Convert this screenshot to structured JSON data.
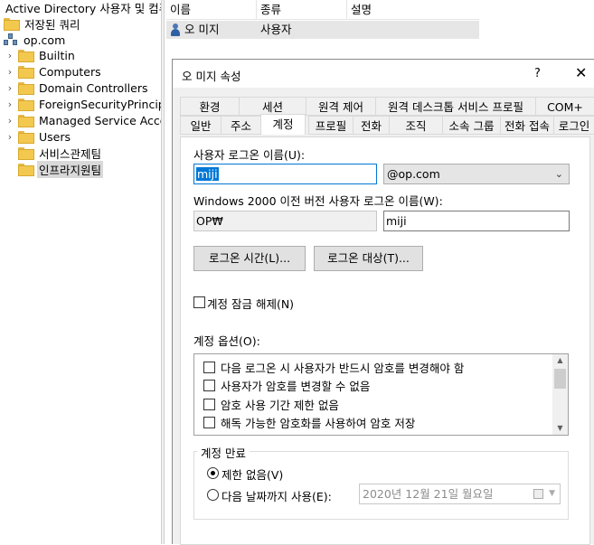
{
  "tree": {
    "title": "Active Directory 사용자 및 컴퓨",
    "saved_queries": "저장된 쿼리",
    "domain": "op.com",
    "items": [
      {
        "label": "Builtin",
        "expandable": true
      },
      {
        "label": "Computers",
        "expandable": true
      },
      {
        "label": "Domain Controllers",
        "expandable": true
      },
      {
        "label": "ForeignSecurityPrincipa",
        "expandable": true
      },
      {
        "label": "Managed Service Acco",
        "expandable": true
      },
      {
        "label": "Users",
        "expandable": true
      },
      {
        "label": "서비스관제팀",
        "expandable": false
      },
      {
        "label": "인프라지원팀",
        "expandable": false,
        "selected": true
      }
    ]
  },
  "list": {
    "columns": [
      "이름",
      "종류",
      "설명"
    ],
    "rows": [
      {
        "name": "오 미지",
        "type": "사용자",
        "description": ""
      }
    ]
  },
  "dialog": {
    "title": "오 미지 속성",
    "help": "?",
    "close": "✕",
    "tabs_row1": [
      "환경",
      "세션",
      "원격 제어",
      "원격 데스크톱 서비스 프로필",
      "COM+"
    ],
    "tabs_row2": [
      "일반",
      "주소",
      "계정",
      "프로필",
      "전화",
      "조직",
      "소속 그룹",
      "전화 접속",
      "로그인"
    ],
    "active_tab": "계정",
    "logon_name_label": "사용자 로그온 이름(U):",
    "logon_name_value": "miji",
    "domain_suffix": "@op.com",
    "pre2000_label": "Windows 2000 이전 버전 사용자 로그온 이름(W):",
    "pre2000_domain": "OP₩",
    "pre2000_user": "miji",
    "logon_hours_button": "로그온 시간(L)...",
    "logon_to_button": "로그온 대상(T)...",
    "unlock_label": "계정 잠금 해제(N)",
    "account_options_label": "계정 옵션(O):",
    "account_options": [
      "다음 로그온 시 사용자가 반드시 암호를 변경해야 함",
      "사용자가 암호를 변경할 수 없음",
      "암호 사용 기간 제한 없음",
      "해독 가능한 암호화를 사용하여 암호 저장"
    ],
    "expiry_legend": "계정 만료",
    "never_label": "제한 없음(V)",
    "end_of_label": "다음 날짜까지 사용(E):",
    "expiry_date": "2020년 12월 21일 월요일"
  },
  "colors": {
    "selection": "#0078d7",
    "dialog_bg": "#f0f0f0",
    "folder": "#f3c84f"
  }
}
